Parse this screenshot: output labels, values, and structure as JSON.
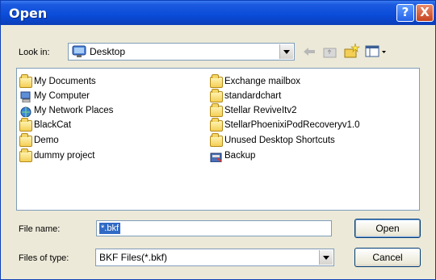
{
  "window": {
    "title": "Open",
    "help_label": "?",
    "close_label": "X"
  },
  "toolbar": {
    "look_in_label": "Look in:",
    "location": "Desktop"
  },
  "files_left": [
    "My Documents",
    "My Computer",
    "My Network Places",
    "BlackCat",
    "Demo",
    "dummy project"
  ],
  "files_right": [
    "Exchange mailbox",
    "standardchart",
    "Stellar ReviveItv2",
    "StellarPhoenixiPodRecoveryv1.0",
    "Unused Desktop Shortcuts",
    "Backup"
  ],
  "form": {
    "file_name_label": "File name:",
    "file_name_value": "*.bkf",
    "file_type_label": "Files of type:",
    "file_type_value": "BKF Files(*.bkf)"
  },
  "buttons": {
    "open_label": "Open",
    "cancel_label": "Cancel"
  },
  "colors": {
    "titlebar": "#0a4bd8",
    "dialog_bg": "#ece9d8",
    "selection": "#316ac5"
  }
}
